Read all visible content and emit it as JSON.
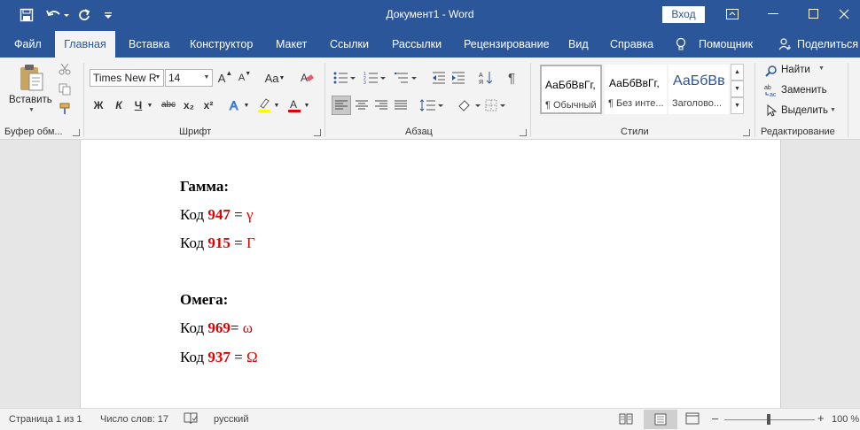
{
  "title_bar": {
    "document_title": "Документ1  -  Word",
    "signin_label": "Вход"
  },
  "tabs": [
    "Файл",
    "Главная",
    "Вставка",
    "Конструктор",
    "Макет",
    "Ссылки",
    "Рассылки",
    "Рецензирование",
    "Вид",
    "Справка",
    "Помощник",
    "Поделиться"
  ],
  "ribbon": {
    "clipboard": {
      "paste_label": "Вставить",
      "group_label": "Буфер обм..."
    },
    "font": {
      "font_name": "Times New R",
      "font_size": "14",
      "group_label": "Шрифт",
      "bold": "Ж",
      "italic": "К",
      "underline": "Ч",
      "strike": "abc",
      "sub": "x₂",
      "sup": "x²"
    },
    "paragraph": {
      "group_label": "Абзац"
    },
    "styles": {
      "group_label": "Стили",
      "items": [
        {
          "sample": "АаБбВвГг,",
          "name": "¶ Обычный"
        },
        {
          "sample": "АаБбВвГг,",
          "name": "¶ Без инте..."
        },
        {
          "sample": "АаБбВв",
          "name": "Заголово..."
        }
      ]
    },
    "editing": {
      "find": "Найти",
      "replace": "Заменить",
      "select": "Выделить",
      "group_label": "Редактирование"
    }
  },
  "document": {
    "gamma_heading": "Гамма:",
    "gamma_lines": [
      {
        "prefix": "Код ",
        "code": "947",
        "eq": " = ",
        "symbol": "γ"
      },
      {
        "prefix": "Код ",
        "code": "915",
        "eq": " = ",
        "symbol": "Г"
      }
    ],
    "omega_heading": "Омега:",
    "omega_lines": [
      {
        "prefix": "Код ",
        "code": "969",
        "eq": "= ",
        "symbol": "ω"
      },
      {
        "prefix": "Код ",
        "code": "937",
        "eq": " = ",
        "symbol": "Ω"
      }
    ]
  },
  "status_bar": {
    "page": "Страница 1 из 1",
    "words": "Число слов: 17",
    "language": "русский",
    "zoom": "100 %"
  },
  "colors": {
    "accent": "#2b579a",
    "code_red": "#e00000"
  }
}
